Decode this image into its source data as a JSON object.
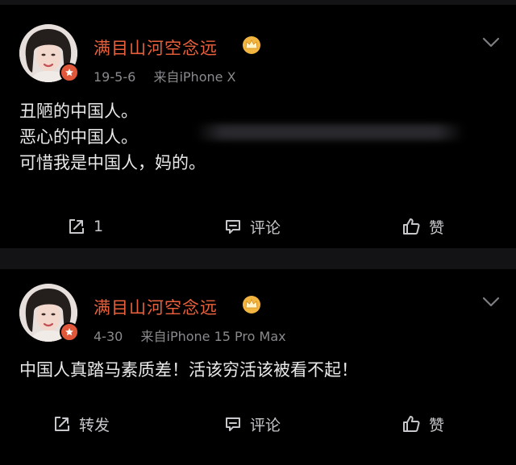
{
  "posts": [
    {
      "username": "满目山河空念远",
      "date": "19-5-6",
      "source": "来自iPhone X",
      "content_lines": [
        "丑陋的中国人。",
        "恶心的中国人。",
        "可惜我是中国人，妈的。"
      ],
      "actions": {
        "repost": "1",
        "comment": "评论",
        "like": "赞"
      }
    },
    {
      "username": "满目山河空念远",
      "date": "4-30",
      "source": "来自iPhone 15 Pro Max",
      "content_lines": [
        "中国人真踏马素质差！活该穷活该被看不起！"
      ],
      "actions": {
        "repost": "转发",
        "comment": "评论",
        "like": "赞"
      }
    }
  ],
  "colors": {
    "username": "#e8613c",
    "text": "#e9e9ea",
    "meta": "#8a8a8e",
    "background": "#000000",
    "separator": "#131316"
  },
  "icons": [
    "crown-icon",
    "verified-badge-icon",
    "chevron-down-icon",
    "repost-icon",
    "comment-icon",
    "like-icon"
  ]
}
